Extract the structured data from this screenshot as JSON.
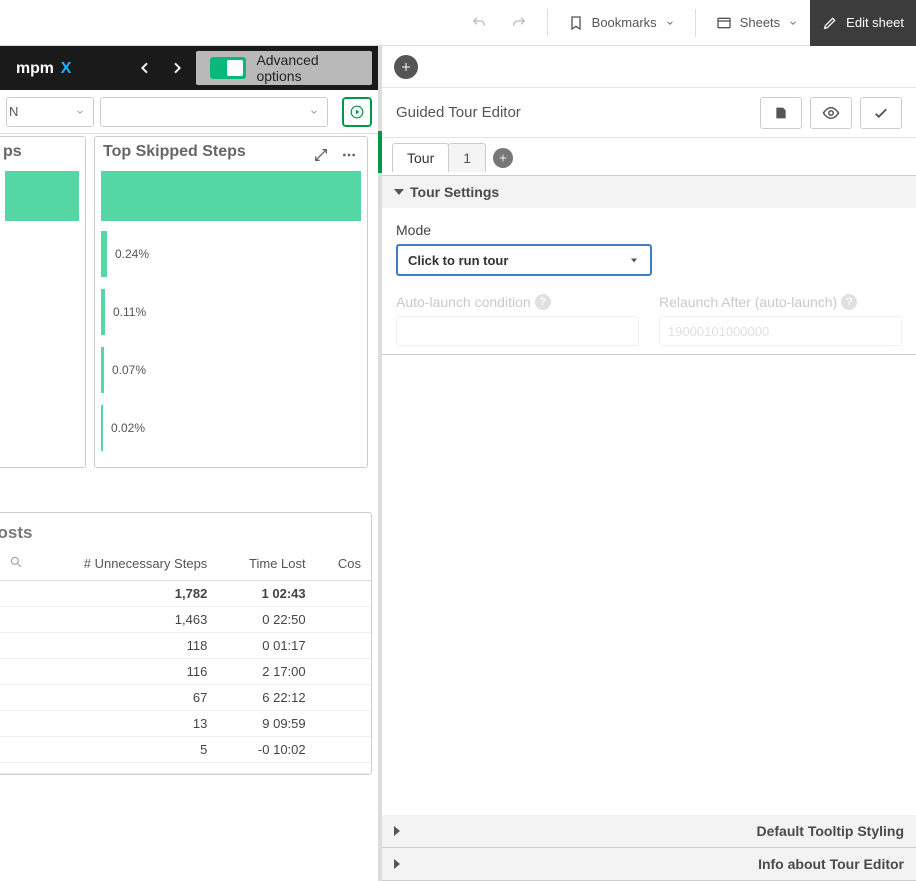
{
  "topbar": {
    "bookmarks": "Bookmarks",
    "sheets": "Sheets",
    "edit_sheet": "Edit sheet"
  },
  "leftbar": {
    "logo": "mpmX",
    "advanced_options": "Advanced options"
  },
  "filter": {
    "left_value": "N"
  },
  "charts": {
    "left_title": "ps",
    "right_title": "Top Skipped Steps"
  },
  "chart_data": {
    "type": "bar",
    "title": "Top Skipped Steps",
    "orientation": "horizontal",
    "series": [
      {
        "name": "Top Skipped Steps",
        "values_pct": [
          99.56,
          0.24,
          0.11,
          0.07,
          0.02
        ]
      }
    ],
    "labels_shown": [
      "",
      "0.24%",
      "0.11%",
      "0.07%",
      "0.02%"
    ],
    "xlabel": "",
    "ylabel": ""
  },
  "table": {
    "title": "y Steps and Reduce Costs",
    "columns": [
      "# Unnecessary Steps",
      "Time Lost",
      "Cos"
    ],
    "totals": {
      "steps": "1,782",
      "time": "1 02:43"
    },
    "rows": [
      {
        "steps": "1,463",
        "time": "0 22:50"
      },
      {
        "steps": "118",
        "time": "0 01:17"
      },
      {
        "steps": "116",
        "time": "2 17:00"
      },
      {
        "steps": "67",
        "time": "6 22:12"
      },
      {
        "steps": "13",
        "time": "9 09:59"
      },
      {
        "steps": "5",
        "time": "-0 10:02"
      }
    ]
  },
  "editor": {
    "title": "Guided Tour Editor",
    "tab_tour": "Tour",
    "tab_1": "1",
    "acc_tour_settings": "Tour Settings",
    "acc_tooltip": "Default Tooltip Styling",
    "acc_info": "Info about Tour Editor",
    "mode_label": "Mode",
    "mode_value": "Click to run tour",
    "auto_launch_label": "Auto-launch condition",
    "relaunch_label": "Relaunch After (auto-launch)",
    "relaunch_value": "19000101000000"
  }
}
